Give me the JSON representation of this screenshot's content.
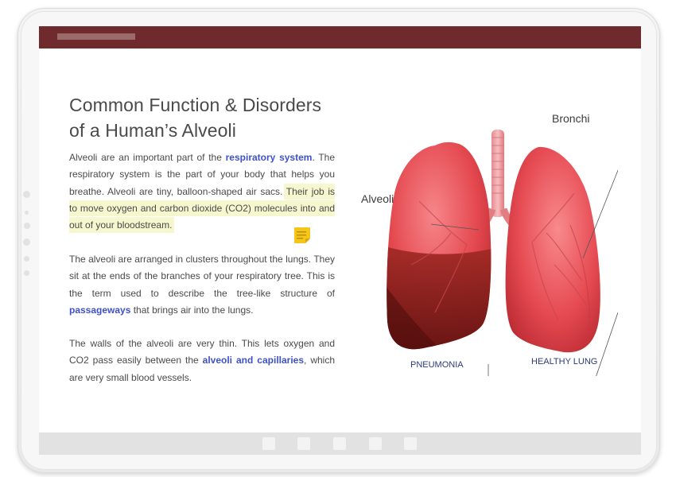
{
  "lesson": {
    "title": "Common Function & Disorders of a Human’s Alveoli",
    "p1": {
      "a": "Alveoli are an important part of the ",
      "link1": "respiratory system",
      "b": ". The respiratory system is the part of your body that helps you breathe. Alveoli are tiny, balloon-shaped air sacs. ",
      "highlight": "Their job is to move oxygen and carbon dioxide (CO2) molecules into and out of your bloodstream."
    },
    "p2": {
      "a": "The alveoli are arranged in clusters throughout the lungs. They sit at the ends of the branches of your respiratory tree. This is the term used to describe the tree-like structure of ",
      "link": "passageways",
      "b": " that brings air into the lungs."
    },
    "p3": {
      "a": "The walls of the alveoli are very thin. This lets oxygen and CO2 pass easily between the ",
      "link": "alveoli and capillaries",
      "b": ", which are very small blood vessels."
    }
  },
  "figure": {
    "labels": {
      "bronchi": "Bronchi",
      "alveoli": "Alveoli",
      "pneumonia": "PNEUMONIA",
      "healthy": "HEALTHY LUNG"
    }
  },
  "colors": {
    "header": "#6e2a2c",
    "link": "#3f51c6",
    "highlight": "#f6f6cf",
    "note": "#f5c518"
  },
  "icons": [
    "sticky-note-icon"
  ]
}
